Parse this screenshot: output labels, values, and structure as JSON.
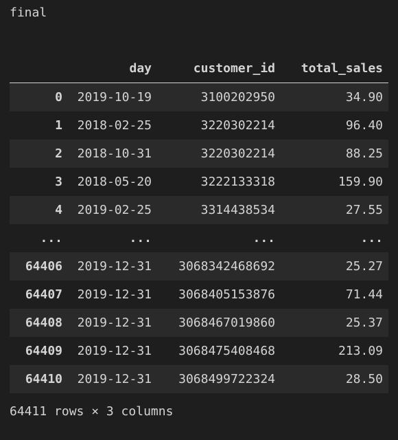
{
  "var_name": "final",
  "columns": [
    "",
    "day",
    "customer_id",
    "total_sales"
  ],
  "rows_top": [
    {
      "index": "0",
      "day": "2019-10-19",
      "customer_id": "3100202950",
      "total_sales": "34.90"
    },
    {
      "index": "1",
      "day": "2018-02-25",
      "customer_id": "3220302214",
      "total_sales": "96.40"
    },
    {
      "index": "2",
      "day": "2018-10-31",
      "customer_id": "3220302214",
      "total_sales": "88.25"
    },
    {
      "index": "3",
      "day": "2018-05-20",
      "customer_id": "3222133318",
      "total_sales": "159.90"
    },
    {
      "index": "4",
      "day": "2019-02-25",
      "customer_id": "3314438534",
      "total_sales": "27.55"
    }
  ],
  "ellipsis": "...",
  "rows_bottom": [
    {
      "index": "64406",
      "day": "2019-12-31",
      "customer_id": "3068342468692",
      "total_sales": "25.27"
    },
    {
      "index": "64407",
      "day": "2019-12-31",
      "customer_id": "3068405153876",
      "total_sales": "71.44"
    },
    {
      "index": "64408",
      "day": "2019-12-31",
      "customer_id": "3068467019860",
      "total_sales": "25.37"
    },
    {
      "index": "64409",
      "day": "2019-12-31",
      "customer_id": "3068475408468",
      "total_sales": "213.09"
    },
    {
      "index": "64410",
      "day": "2019-12-31",
      "customer_id": "3068499722324",
      "total_sales": "28.50"
    }
  ],
  "summary": "64411 rows × 3 columns"
}
